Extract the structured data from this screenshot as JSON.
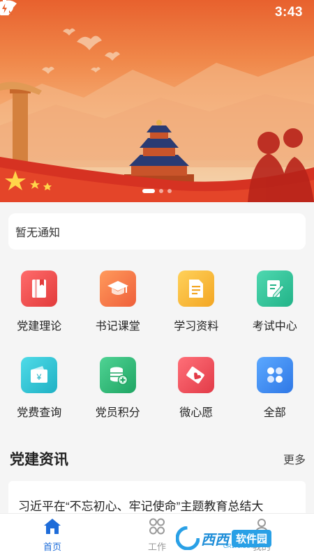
{
  "status_bar": {
    "time": "3:43"
  },
  "banner": {
    "slide_count": 3,
    "active_slide": 1
  },
  "notice": {
    "text": "暂无通知"
  },
  "menu": {
    "items": [
      {
        "label": "党建理论",
        "icon": "book-icon",
        "color": "#ee4a4a"
      },
      {
        "label": "书记课堂",
        "icon": "graduation-cap-icon",
        "color": "#f3744a"
      },
      {
        "label": "学习资料",
        "icon": "document-icon",
        "color": "#f5b731"
      },
      {
        "label": "考试中心",
        "icon": "edit-note-icon",
        "color": "#2fc49c"
      },
      {
        "label": "党费查询",
        "icon": "wallet-yuan-icon",
        "color": "#2bc3d4"
      },
      {
        "label": "党员积分",
        "icon": "coins-plus-icon",
        "color": "#30b877"
      },
      {
        "label": "微心愿",
        "icon": "heart-card-icon",
        "color": "#ef4d58"
      },
      {
        "label": "全部",
        "icon": "all-apps-icon",
        "color": "#3b8df0"
      }
    ]
  },
  "news": {
    "title": "党建资讯",
    "more": "更多",
    "items": [
      {
        "headline": "习近平在“不忘初心、牢记使命”主题教育总结大"
      }
    ]
  },
  "tabbar": {
    "tabs": [
      {
        "label": "首页",
        "active": true
      },
      {
        "label": "工作",
        "active": false
      },
      {
        "label": "我的",
        "active": false
      }
    ]
  },
  "watermark": {
    "brand": "西西",
    "sub": "软件园",
    "url": "CR173.COM"
  },
  "colors": {
    "accent": "#1e6cd9",
    "banner_red": "#e8612e"
  }
}
